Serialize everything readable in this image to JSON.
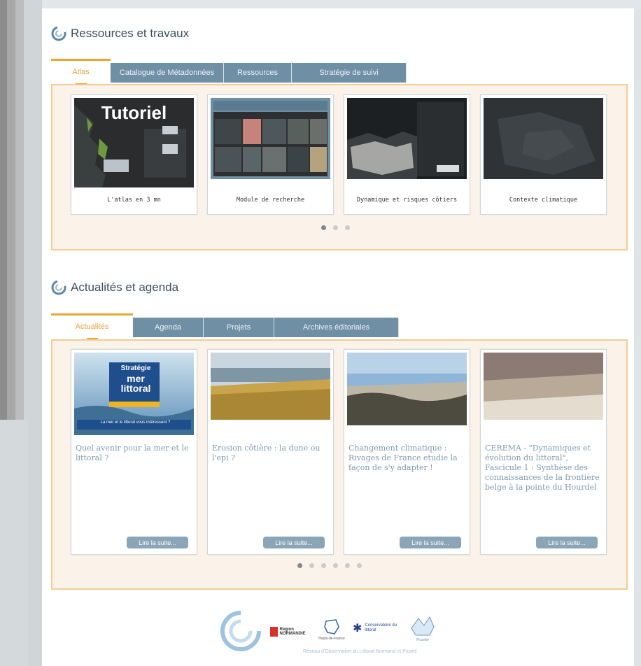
{
  "sections": {
    "resources": {
      "title": "Ressources et travaux",
      "tabs": [
        "Atlas",
        "Catalogue de Métadonnées",
        "Ressources",
        "Stratégie de suivi"
      ],
      "cards": [
        {
          "caption": "L'atlas en 3 mn",
          "thumb_text": "Tutoriel"
        },
        {
          "caption": "Module de recherche"
        },
        {
          "caption": "Dynamique et risques côtiers"
        },
        {
          "caption": "Contexte climatique"
        }
      ],
      "dots": 3,
      "active_dot": 1
    },
    "news": {
      "title": "Actualités et agenda",
      "tabs": [
        "Actualités",
        "Agenda",
        "Projets",
        "Archives éditoriales"
      ],
      "cards": [
        {
          "title": "Quel avenir pour la mer et le littoral ?",
          "button": "Lire la suite...",
          "thumb_lines": [
            "Stratégie",
            "mer",
            "littoral"
          ],
          "thumb_sub": "La mer et le littoral vous intéressent ?"
        },
        {
          "title": "Erosion côtière : la dune ou l'epi ?",
          "button": "Lire la suite..."
        },
        {
          "title": "Changement climatique : Rivages de France etudie la façon de s'y adapter !",
          "button": "Lire la suite..."
        },
        {
          "title": "CEREMA - \"Dynamiques et évolution du littoral\", Fascicule 1 : Synthèse des connaissances de la frontière belge à la pointe du Hourdel",
          "button": "Lire la suite..."
        }
      ],
      "dots": 6,
      "active_dot": 1
    }
  },
  "footer": {
    "logos": [
      "Région NORMANDIE",
      "Hauts-de-France",
      "Conservatoire du littoral",
      "Picardie"
    ],
    "caption": "Réseau d'Observation du Littoral Normand et Picard"
  },
  "colors": {
    "accent_orange": "#eba535",
    "tab_blue": "#6f8fa4",
    "link_blue": "#7f9bb0",
    "panel_bg": "#fbf3e9"
  }
}
